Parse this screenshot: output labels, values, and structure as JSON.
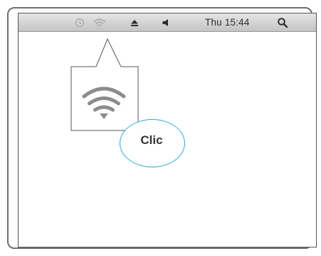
{
  "menubar": {
    "clock": "Thu 15:44",
    "icons": [
      "time-machine-icon",
      "wifi-icon",
      "eject-icon",
      "volume-icon",
      "spotlight-search-icon"
    ]
  },
  "callout": {
    "icon": "wifi-icon"
  },
  "hint": {
    "label": "Clic",
    "ring_color": "#2ba8d9"
  }
}
